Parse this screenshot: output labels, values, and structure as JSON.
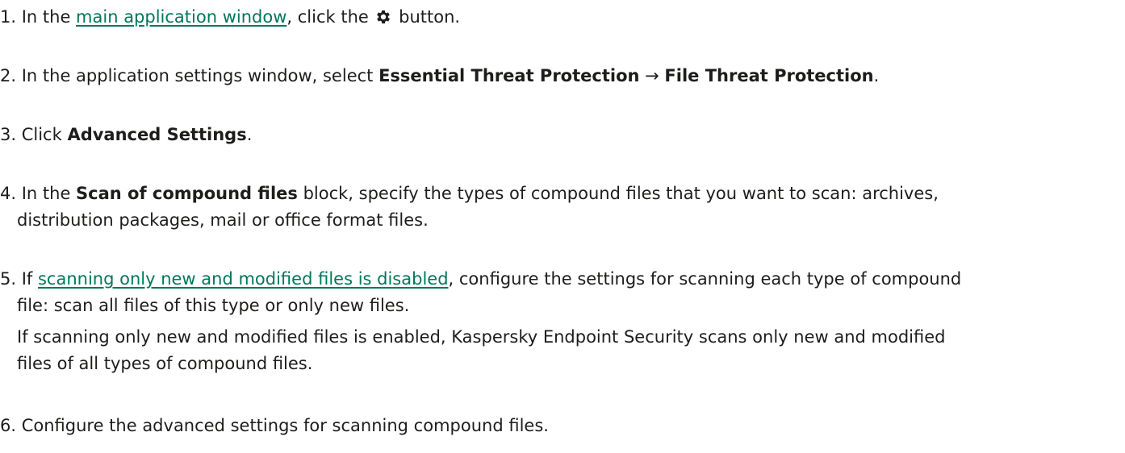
{
  "steps": [
    {
      "number": "1.",
      "pre": " In the ",
      "link": "main application window",
      "mid": ", click the ",
      "icon": "gear-icon",
      "post": " button."
    },
    {
      "number": "2.",
      "pre": " In the application settings window, select ",
      "bold1": "Essential Threat Protection",
      "arrow": " → ",
      "bold2": "File Threat Protection",
      "post": "."
    },
    {
      "number": "3.",
      "pre": " Click ",
      "bold": "Advanced Settings",
      "post": "."
    },
    {
      "number": "4.",
      "pre": " In the ",
      "bold": "Scan of compound files",
      "post": " block, specify the types of compound files that you want to scan: archives,",
      "line2": "distribution packages, mail or office format files."
    },
    {
      "number": "5.",
      "pre": " If ",
      "link": "scanning only new and modified files is disabled",
      "post": ", configure the settings for scanning each type of compound",
      "line2": "file: scan all files of this type or only new files.",
      "note_line1": "If scanning only new and modified files is enabled, Kaspersky Endpoint Security scans only new and modified",
      "note_line2": "files of all types of compound files."
    },
    {
      "number": "6.",
      "pre": " Configure the advanced settings for scanning compound files."
    }
  ],
  "colors": {
    "text": "#1d1d1b",
    "link": "#00775a",
    "background": "#ffffff"
  }
}
